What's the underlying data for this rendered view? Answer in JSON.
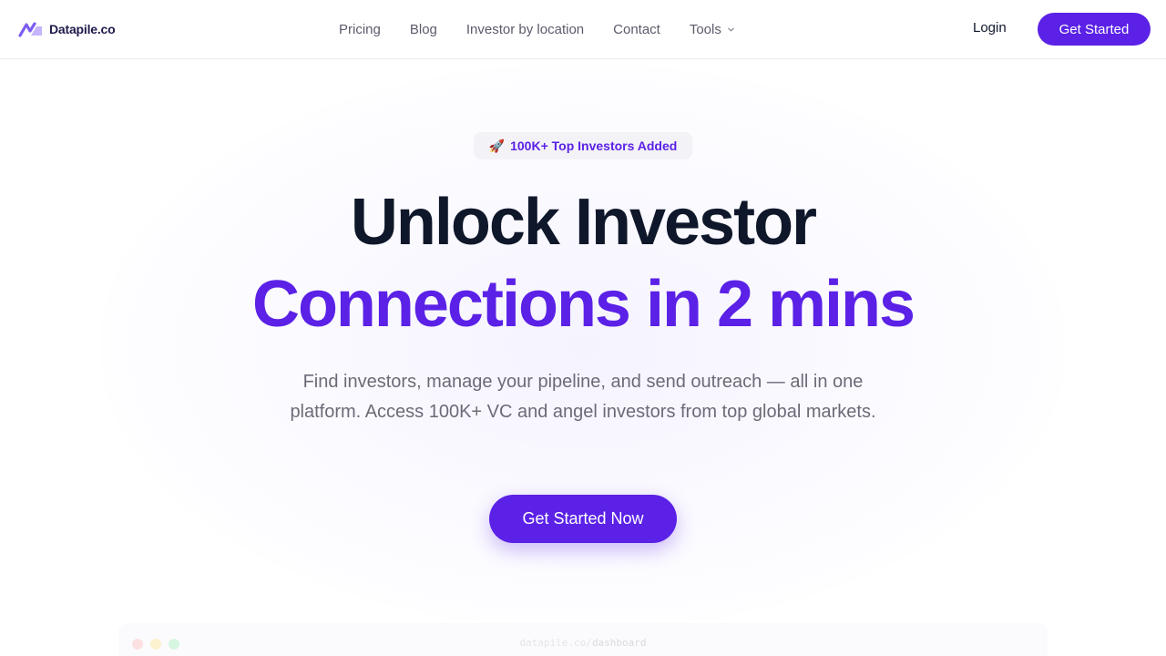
{
  "brand": {
    "name": "Datapile.co",
    "logo_icon": "datapile-logo-icon",
    "accent": "#5b21e6"
  },
  "nav": {
    "links": [
      {
        "label": "Pricing"
      },
      {
        "label": "Blog"
      },
      {
        "label": "Investor by location"
      },
      {
        "label": "Contact"
      },
      {
        "label": "Tools",
        "icon": "chevron-down-icon"
      }
    ],
    "login_label": "Login",
    "get_started_label": "Get Started"
  },
  "hero": {
    "badge_icon": "🚀",
    "badge_text": "100K+ Top Investors Added",
    "headline_line1": "Unlock Investor",
    "headline_line2": "Connections in 2 mins",
    "subtitle": "Find investors, manage your pipeline, and send outreach — all in one platform. Access 100K+ VC and angel investors from top global markets.",
    "cta_label": "Get Started Now"
  },
  "preview": {
    "url_domain": "datapile.co/",
    "url_path": "dashboard"
  },
  "colors": {
    "primary": "#5b21e6",
    "heading": "#0f172a",
    "body_text": "#6b6b78",
    "badge_bg": "#f3f2f7"
  }
}
